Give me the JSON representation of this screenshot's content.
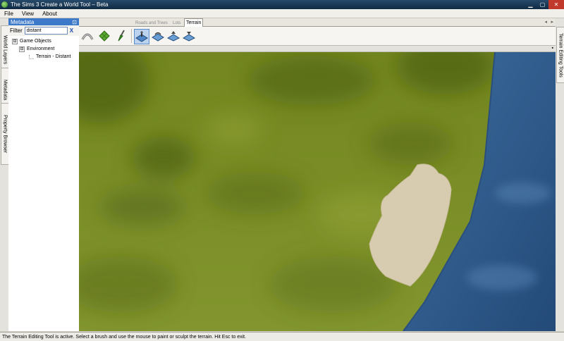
{
  "window": {
    "title": "The Sims 3 Create a World Tool – Beta"
  },
  "menu": {
    "items": [
      "File",
      "View",
      "About"
    ]
  },
  "left_dock": {
    "tabs": [
      "World Layers",
      "Metadata",
      "Property Browser"
    ]
  },
  "right_dock": {
    "tabs": [
      "Terrain Editing Tools"
    ]
  },
  "metadata_panel": {
    "title": "Metadata",
    "filter_label": "Filter",
    "filter_value": "distant",
    "clear_label": "X",
    "tree": [
      {
        "label": "Game Objects",
        "expander": "⊟"
      },
      {
        "label": "Environment",
        "expander": "⊟"
      },
      {
        "label": "Terrain - Distant"
      }
    ]
  },
  "tabs": {
    "items": [
      "Roads and Trees",
      "Lots",
      "Terrain"
    ],
    "active": "Terrain"
  },
  "toolbar": {
    "icons": [
      "road-curve-icon",
      "grid-tile-icon",
      "paint-brush-icon",
      "terrain-sculpt-icon",
      "terrain-smooth-icon",
      "terrain-raise-icon",
      "terrain-lower-icon"
    ],
    "selected": "terrain-sculpt-icon"
  },
  "colors": {
    "terrain": "#7b8c29",
    "terrain_dark": "#55681a",
    "water": "#2f5b8c",
    "sand": "#d8ccb0",
    "panel_header": "#3d79c9"
  },
  "status": {
    "text": "The Terrain Editing Tool is active. Select a brush and use the mouse to paint or sculpt the terrain. Hit Esc to exit."
  }
}
